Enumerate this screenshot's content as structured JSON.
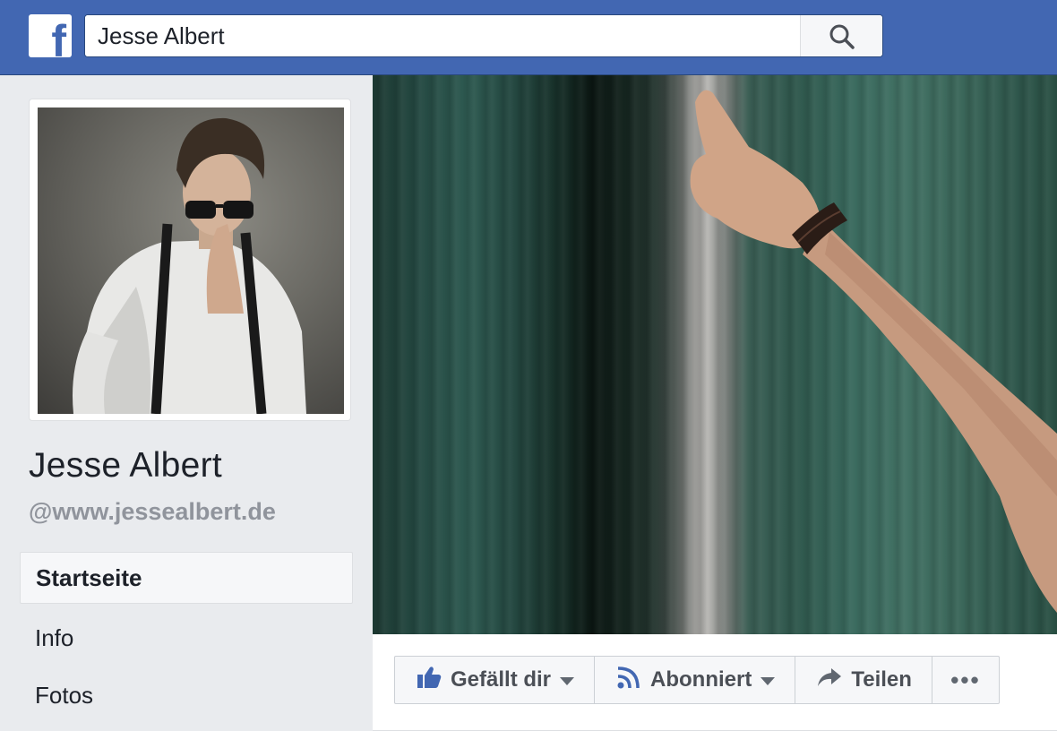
{
  "header": {
    "logo_letter": "f",
    "search_value": "Jesse Albert"
  },
  "icons": {
    "logo": "facebook-logo-icon",
    "search": "search-icon",
    "like": "thumbs-up-icon",
    "follow": "rss-feed-icon",
    "share": "share-arrow-icon",
    "more": "more-dots-icon"
  },
  "profile": {
    "name": "Jesse Albert",
    "handle": "@www.jessealbert.de"
  },
  "nav": {
    "items": [
      {
        "label": "Startseite",
        "active": true
      },
      {
        "label": "Info",
        "active": false
      },
      {
        "label": "Fotos",
        "active": false
      }
    ]
  },
  "actions": {
    "like_label": "Gefällt dir",
    "follow_label": "Abonniert",
    "share_label": "Teilen",
    "more_label": "•••"
  },
  "colors": {
    "brand_blue": "#4267b2",
    "page_bg": "#e9ebee",
    "text_dark": "#1d2129",
    "text_muted": "#90949c"
  }
}
